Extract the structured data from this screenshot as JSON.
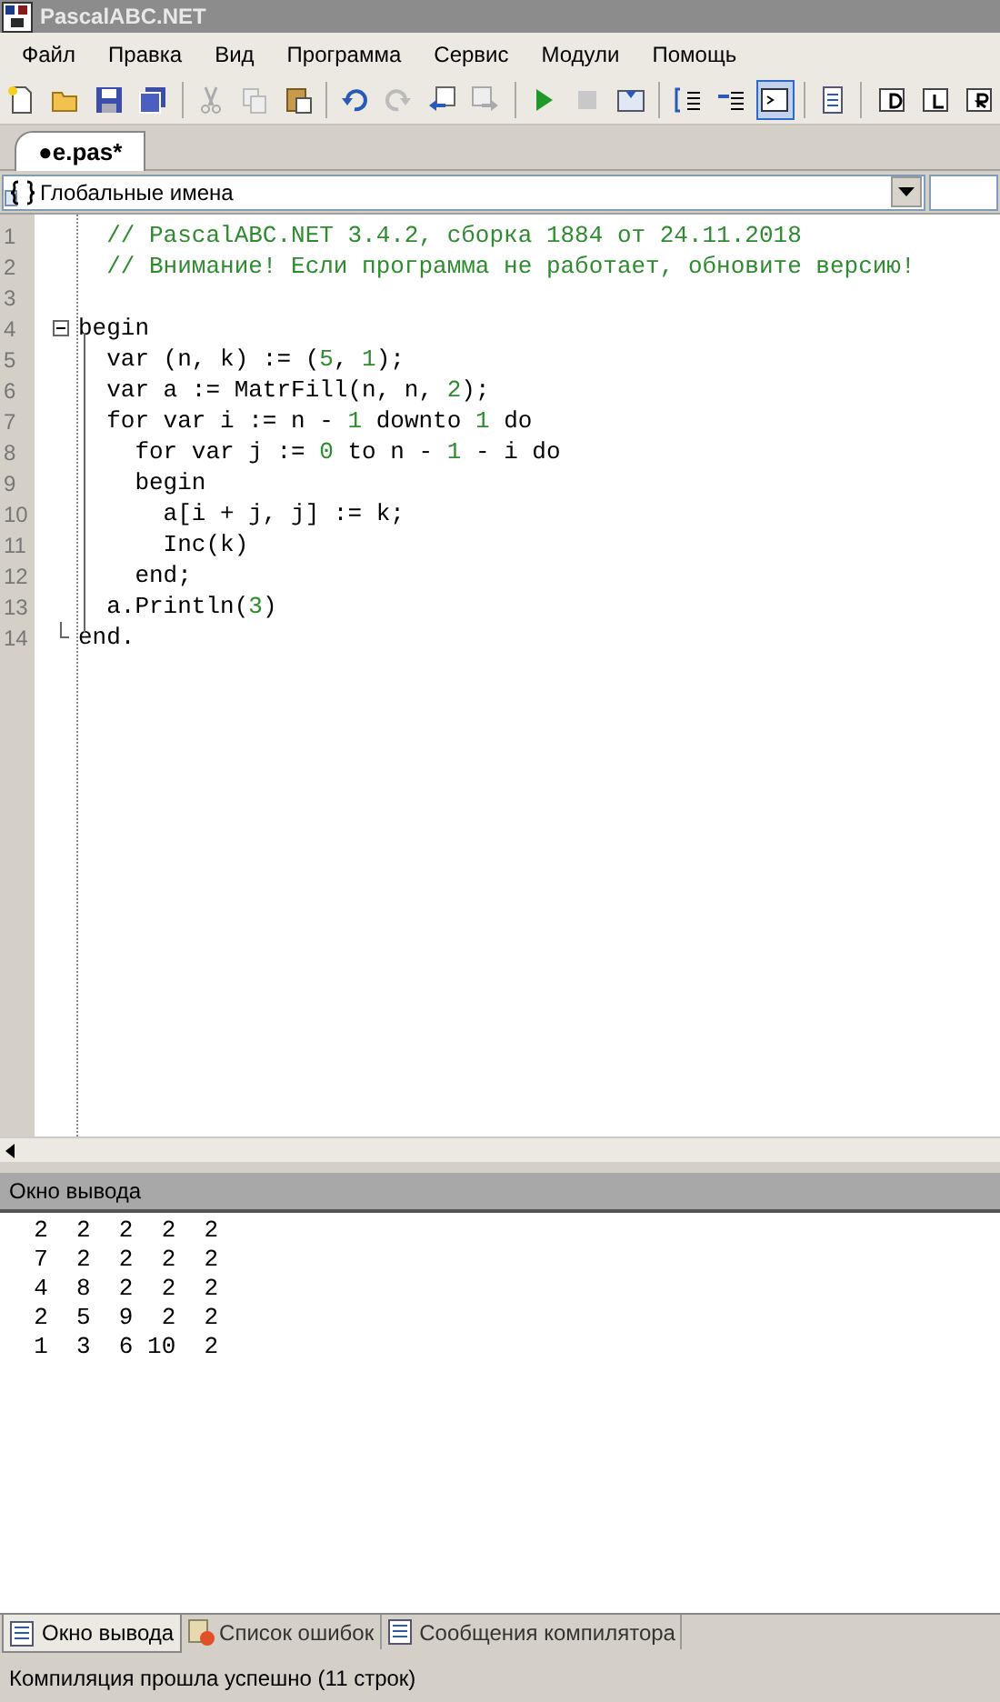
{
  "window": {
    "title": "PascalABC.NET"
  },
  "menu": [
    "Файл",
    "Правка",
    "Вид",
    "Программа",
    "Сервис",
    "Модули",
    "Помощь"
  ],
  "toolbar": [
    {
      "kind": "new",
      "selected": false
    },
    {
      "kind": "open",
      "selected": false
    },
    {
      "kind": "save",
      "selected": false
    },
    {
      "kind": "saveall",
      "selected": false
    },
    {
      "kind": "sep"
    },
    {
      "kind": "cut",
      "selected": false
    },
    {
      "kind": "copy",
      "selected": false
    },
    {
      "kind": "paste",
      "selected": false
    },
    {
      "kind": "sep"
    },
    {
      "kind": "undo",
      "selected": false
    },
    {
      "kind": "redo",
      "selected": false
    },
    {
      "kind": "back",
      "selected": false
    },
    {
      "kind": "forward",
      "selected": false
    },
    {
      "kind": "sep"
    },
    {
      "kind": "run",
      "selected": false
    },
    {
      "kind": "stop",
      "selected": false
    },
    {
      "kind": "compile",
      "selected": false
    },
    {
      "kind": "sep"
    },
    {
      "kind": "stepinto",
      "selected": false
    },
    {
      "kind": "stepover",
      "selected": false
    },
    {
      "kind": "console",
      "selected": true
    },
    {
      "kind": "sep"
    },
    {
      "kind": "doc",
      "selected": false
    },
    {
      "kind": "sep"
    },
    {
      "kind": "fmtd",
      "selected": false
    },
    {
      "kind": "fmtl",
      "selected": false
    },
    {
      "kind": "fmtr",
      "selected": false
    }
  ],
  "file_tabs": [
    {
      "label": "●e.pas*",
      "selected": true
    }
  ],
  "scope_combo": {
    "value": "Глобальные имена"
  },
  "editor": {
    "lines": [
      {
        "number": "1",
        "tokens": [
          {
            "kind": "comment",
            "text": "  // PascalABC.NET 3.4.2, сборка 1884 от 24.11.2018"
          }
        ]
      },
      {
        "number": "2",
        "tokens": [
          {
            "kind": "comment",
            "text": "  // Внимание! Если программа не работает, обновите версию!"
          }
        ]
      },
      {
        "number": "3"
      },
      {
        "number": "4",
        "kind": "fold_start",
        "tokens": [
          {
            "kind": "code",
            "text": "begin"
          }
        ]
      },
      {
        "number": "5",
        "tokens": [
          {
            "kind": "code",
            "text": "  var (n, k) := ("
          },
          {
            "kind": "number",
            "text": "5"
          },
          {
            "kind": "code",
            "text": ", "
          },
          {
            "kind": "number",
            "text": "1"
          },
          {
            "kind": "code",
            "text": ");"
          }
        ]
      },
      {
        "number": "6",
        "tokens": [
          {
            "kind": "code",
            "text": "  var a := MatrFill(n, n, "
          },
          {
            "kind": "number",
            "text": "2"
          },
          {
            "kind": "code",
            "text": ");"
          }
        ]
      },
      {
        "number": "7",
        "tokens": [
          {
            "kind": "code",
            "text": "  for var i := n - "
          },
          {
            "kind": "number",
            "text": "1"
          },
          {
            "kind": "code",
            "text": " downto "
          },
          {
            "kind": "number",
            "text": "1"
          },
          {
            "kind": "code",
            "text": " do"
          }
        ]
      },
      {
        "number": "8",
        "tokens": [
          {
            "kind": "code",
            "text": "    for var j := "
          },
          {
            "kind": "number",
            "text": "0"
          },
          {
            "kind": "code",
            "text": " to n - "
          },
          {
            "kind": "number",
            "text": "1"
          },
          {
            "kind": "code",
            "text": " - i do"
          }
        ]
      },
      {
        "number": "9",
        "tokens": [
          {
            "kind": "code",
            "text": "    begin"
          }
        ]
      },
      {
        "number": "10",
        "tokens": [
          {
            "kind": "code",
            "text": "      a[i + j, j] := k;"
          }
        ]
      },
      {
        "number": "11",
        "tokens": [
          {
            "kind": "code",
            "text": "      Inc(k)"
          }
        ]
      },
      {
        "number": "12",
        "tokens": [
          {
            "kind": "code",
            "text": "    end;"
          }
        ]
      },
      {
        "number": "13",
        "tokens": [
          {
            "kind": "code",
            "text": "  a.Println("
          },
          {
            "kind": "number",
            "text": "3"
          },
          {
            "kind": "code",
            "text": ")"
          }
        ]
      },
      {
        "number": "14",
        "kind": "fold_end",
        "tokens": [
          {
            "kind": "code",
            "text": "end."
          }
        ]
      }
    ]
  },
  "output": {
    "title": "Окно вывода",
    "lines": [
      "  2  2  2  2  2",
      "  7  2  2  2  2",
      "  4  8  2  2  2",
      "  2  5  9  2  2",
      "  1  3  6 10  2"
    ]
  },
  "bottom_tabs": [
    {
      "label": "Окно вывода",
      "kind": "output",
      "selected": true
    },
    {
      "label": "Список ошибок",
      "kind": "errors",
      "selected": false
    },
    {
      "label": "Сообщения компилятора",
      "kind": "messages",
      "selected": false
    }
  ],
  "status_bar": "Компиляция прошла успешно (11 строк)"
}
